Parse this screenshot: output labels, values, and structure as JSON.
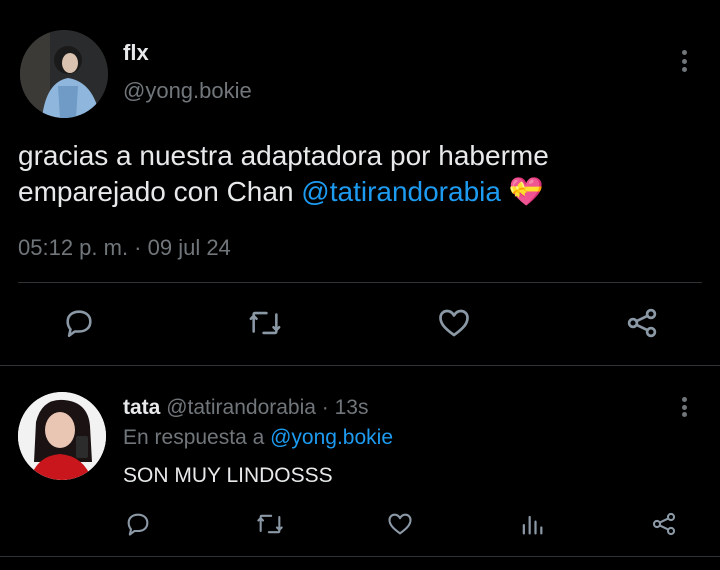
{
  "main_tweet": {
    "author_name": "flx",
    "author_handle": "@yong.bokie",
    "text_line1": "gracias a nuestra adaptadora por haberme",
    "text_line2_plain": "emparejado con Chan",
    "text_mention": "@tatirandorabia",
    "emoji": "💝",
    "timestamp": "05:12 p. m. · 09 jul 24"
  },
  "actions": [
    "reply-icon",
    "retweet-icon",
    "like-icon",
    "share-icon"
  ],
  "reply_tweet": {
    "author_name": "tata",
    "author_handle": "@tatirandorabia",
    "time": "· 13s",
    "in_reply_label": "En respuesta a",
    "in_reply_handle": "@yong.bokie",
    "text": "SON MUY LINDOSSS"
  },
  "reply_actions": [
    "reply-icon",
    "retweet-icon",
    "like-icon",
    "views-icon",
    "share-icon"
  ],
  "colors": {
    "background": "#000000",
    "text": "#e7e9ea",
    "muted": "#71767b",
    "link": "#1d9bf0",
    "divider": "#2f3336"
  }
}
